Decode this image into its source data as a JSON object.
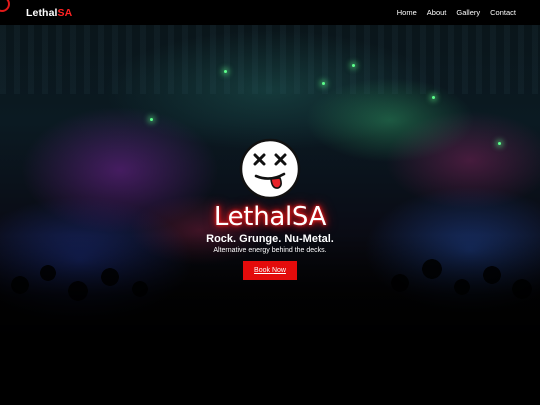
{
  "nav": {
    "brand_main": "Lethal",
    "brand_accent": "SA",
    "links": [
      "Home",
      "About",
      "Gallery",
      "Contact"
    ]
  },
  "hero": {
    "logo_icon": "dizzy-face-tongue-icon",
    "title": "LethalSA",
    "tagline": "Rock. Grunge. Nu-Metal.",
    "subtagline": "Alternative energy behind the decks.",
    "cta_label": "Book Now"
  },
  "colors": {
    "accent": "#e30b0b",
    "nav_background": "#000000",
    "text": "#ffffff"
  }
}
